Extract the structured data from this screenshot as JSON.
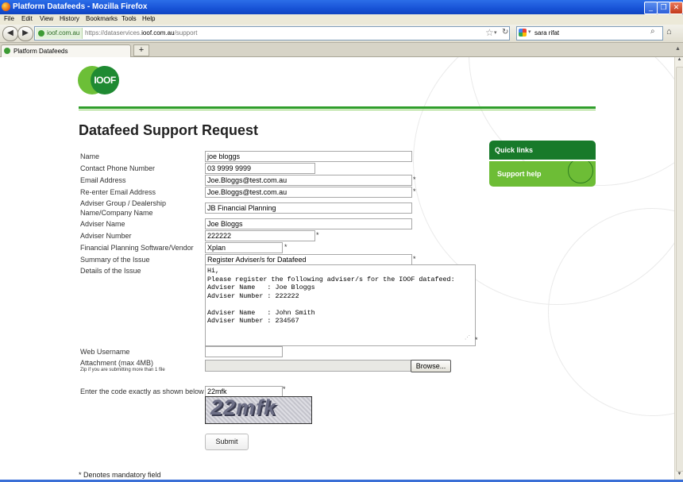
{
  "window": {
    "title": "Platform Datafeeds - Mozilla Firefox"
  },
  "menu": [
    "File",
    "Edit",
    "View",
    "History",
    "Bookmarks",
    "Tools",
    "Help"
  ],
  "navbar": {
    "site_badge": "ioof.com.au",
    "url_prefix": "https://dataservices.",
    "url_domain": "ioof.com.au",
    "url_path": "/support",
    "search_value": "sara rifat"
  },
  "tabs": [
    {
      "label": "Platform Datafeeds"
    }
  ],
  "page": {
    "logo": "IOOF",
    "title": "Datafeed Support Request",
    "sidebar": {
      "quick_links": "Quick links",
      "support_help": "Support help"
    },
    "form": {
      "name": {
        "label": "Name",
        "value": "joe bloggs"
      },
      "phone": {
        "label": "Contact Phone Number",
        "value": "03 9999 9999"
      },
      "email": {
        "label": "Email Address",
        "value": "Joe.Bloggs@test.com.au",
        "required": "*"
      },
      "email2": {
        "label": "Re-enter Email Address",
        "value": "Joe.Bloggs@test.com.au",
        "required": "*"
      },
      "adviser_group": {
        "label_line1": "Adviser Group / Dealership",
        "label_line2": "Name/Company Name",
        "value": "JB Financial Planning"
      },
      "adviser_name": {
        "label": "Adviser Name",
        "value": "Joe Bloggs"
      },
      "adviser_number": {
        "label": "Adviser Number",
        "value": "222222",
        "required": "*"
      },
      "software": {
        "label": "Financial Planning Software/Vendor",
        "value": "Xplan",
        "required": "*"
      },
      "summary": {
        "label": "Summary of the Issue",
        "value": "Register Adviser/s for Datafeed",
        "required": "*"
      },
      "details": {
        "label": "Details of the Issue",
        "value": "Hi,\nPlease register the following adviser/s for the IOOF datafeed:\nAdviser Name   : Joe Bloggs\nAdviser Number : 222222\n\nAdviser Name   : John Smith\nAdviser Number : 234567",
        "required": "*"
      },
      "web_username": {
        "label": "Web Username",
        "value": ""
      },
      "attachment": {
        "label": "Attachment (max 4MB)",
        "hint": "Zip if you are submitting more than 1 file",
        "browse": "Browse..."
      },
      "captcha": {
        "label": "Enter the code exactly as shown below",
        "value": "22mfk",
        "image_text": "22mfk",
        "required": "*"
      },
      "submit": "Submit",
      "footnote": "* Denotes mandatory field"
    }
  },
  "colors": {
    "brand_dark": "#187a2a",
    "brand_light": "#6dbd36",
    "titlebar": "#1752d6"
  }
}
